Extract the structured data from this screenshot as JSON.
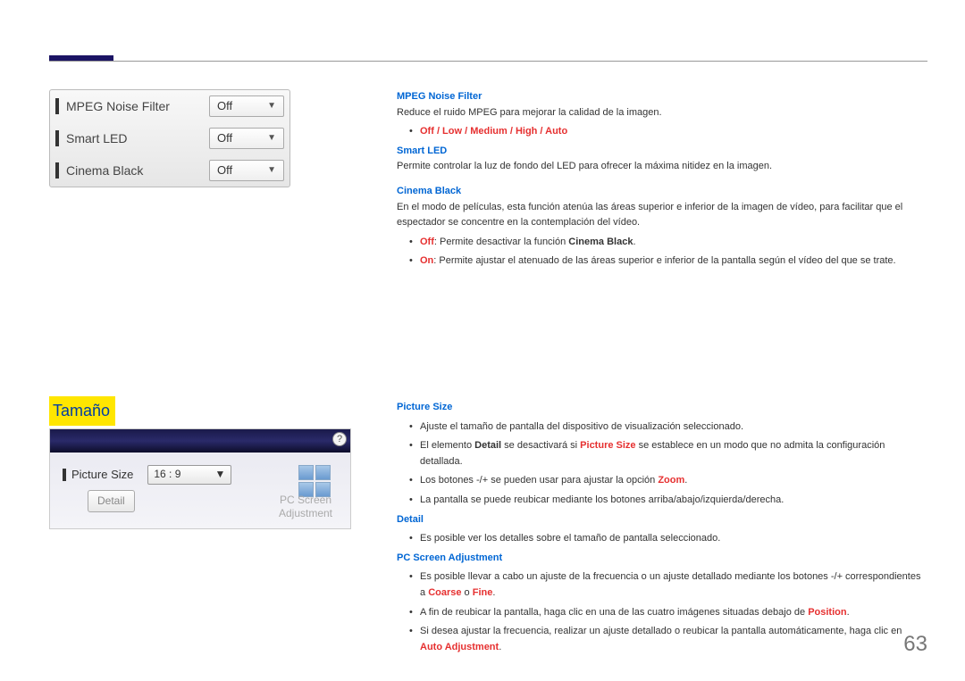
{
  "menu": {
    "items": [
      {
        "label": "MPEG Noise Filter",
        "value": "Off"
      },
      {
        "label": "Smart LED",
        "value": "Off"
      },
      {
        "label": "Cinema Black",
        "value": "Off"
      }
    ]
  },
  "section1": {
    "mpeg_title": "MPEG Noise Filter",
    "mpeg_desc": "Reduce el ruido MPEG para mejorar la calidad de la imagen.",
    "mpeg_options": "Off / Low / Medium / High / Auto",
    "smart_title": "Smart LED",
    "smart_desc": "Permite controlar la luz de fondo del LED para ofrecer la máxima nitidez en la imagen.",
    "cinema_title": "Cinema Black",
    "cinema_desc": "En el modo de películas, esta función atenúa las áreas superior e inferior de la imagen de vídeo, para facilitar que el espectador se concentre en la contemplación del vídeo.",
    "cinema_off_red": "Off",
    "cinema_off_rest": ": Permite desactivar la función ",
    "cinema_off_bold": "Cinema Black",
    "cinema_on_red": "On",
    "cinema_on_rest": ": Permite ajustar el atenuado de las áreas superior e inferior de la pantalla según el vídeo del que se trate."
  },
  "section2_title": "Tamaño",
  "size_panel": {
    "label": "Picture Size",
    "value": "16 : 9",
    "detail": "Detail",
    "pc_adj_line1": "PC Screen",
    "pc_adj_line2": "Adjustment",
    "help": "?"
  },
  "section2": {
    "ps_title": "Picture Size",
    "ps_b1": "Ajuste el tamaño de pantalla del dispositivo de visualización seleccionado.",
    "ps_b2_a": "El elemento ",
    "ps_b2_detail": "Detail",
    "ps_b2_b": " se desactivará si ",
    "ps_b2_ps": "Picture Size",
    "ps_b2_c": " se establece en un modo que no admita la configuración detallada.",
    "ps_b3_a": "Los botones -/+ se pueden usar para ajustar la opción ",
    "ps_b3_zoom": "Zoom",
    "ps_b3_b": ".",
    "ps_b4": "La pantalla se puede reubicar mediante los botones arriba/abajo/izquierda/derecha.",
    "detail_title": "Detail",
    "detail_b1": "Es posible ver los detalles sobre el tamaño de pantalla seleccionado.",
    "pcs_title": "PC Screen Adjustment",
    "pcs_b1_a": "Es posible llevar a cabo un ajuste de la frecuencia o un ajuste detallado mediante los botones -/+ correspondientes a ",
    "pcs_b1_coarse": "Coarse",
    "pcs_b1_or": " o ",
    "pcs_b1_fine": "Fine",
    "pcs_b1_b": ".",
    "pcs_b2_a": "A fin de reubicar la pantalla, haga clic en una de las cuatro imágenes situadas debajo de ",
    "pcs_b2_pos": "Position",
    "pcs_b2_b": ".",
    "pcs_b3_a": "Si desea ajustar la frecuencia, realizar un ajuste detallado o reubicar la pantalla automáticamente, haga clic en ",
    "pcs_b3_auto": "Auto Adjustment",
    "pcs_b3_b": "."
  },
  "page_number": "63"
}
